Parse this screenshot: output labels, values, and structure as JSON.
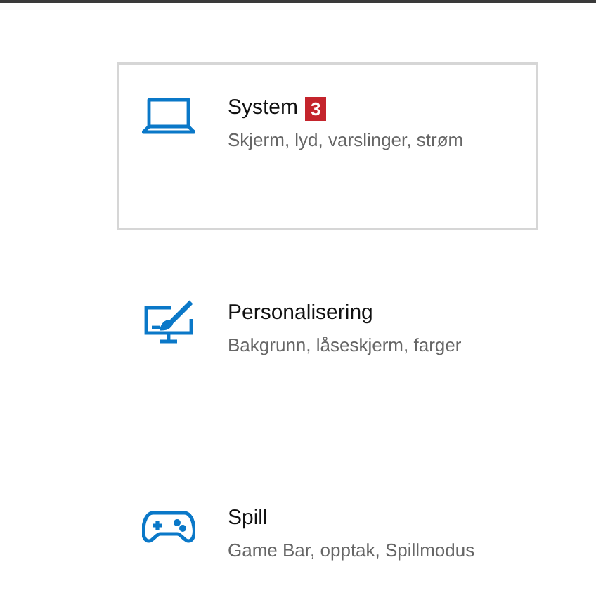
{
  "categories": [
    {
      "kind": "laptop",
      "title": "System",
      "badge": "3",
      "subtitle": "Skjerm, lyd, varslinger, strøm",
      "selected": true
    },
    {
      "kind": "brush",
      "title": "Personalisering",
      "subtitle": "Bakgrunn, låseskjerm, farger",
      "selected": false
    },
    {
      "kind": "gamepad",
      "title": "Spill",
      "subtitle": "Game Bar, opptak, Spillmodus",
      "selected": false
    }
  ]
}
